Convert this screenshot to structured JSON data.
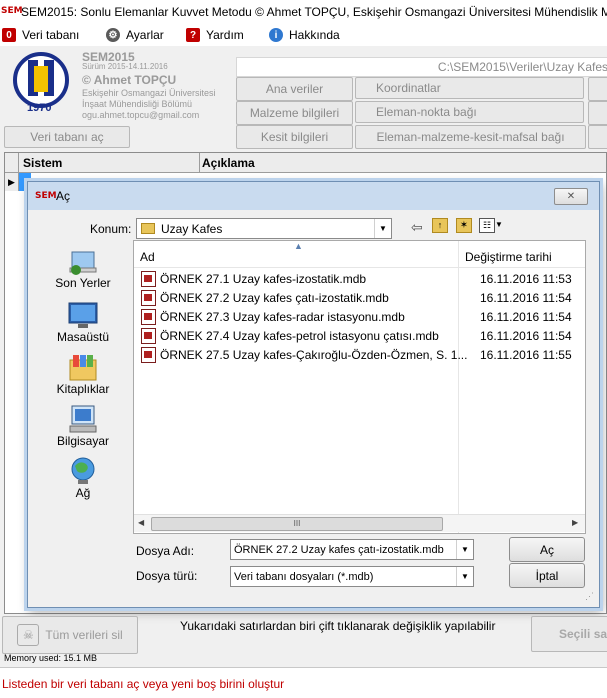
{
  "window": {
    "logo_text": "SEM",
    "title": "SEM2015: Sonlu Elemanlar Kuvvet Metodu  © Ahmet TOPÇU, Eskişehir Osmangazi Üniversitesi Mühendislik M"
  },
  "menu": {
    "items": [
      {
        "label": "Veri tabanı",
        "icon": "zero-icon"
      },
      {
        "label": "Ayarlar",
        "icon": "gear-icon"
      },
      {
        "label": "Yardım",
        "icon": "help-icon"
      },
      {
        "label": "Hakkında",
        "icon": "info-icon"
      }
    ]
  },
  "header": {
    "logo_year": "1970",
    "app_name": "SEM2015",
    "version": "Sürüm 2015-14.11.2016",
    "author": "© Ahmet TOPÇU",
    "university": "Eskişehir Osmangazi Üniversitesi",
    "department": "İnşaat Mühendisliği Bölümü",
    "email": "ogu.ahmet.topcu@gmail.com",
    "open_db_button": "Veri tabanı aç",
    "path": "C:\\SEM2015\\Veriler\\Uzay Kafes",
    "buttons": {
      "ana_veriler": "Ana veriler",
      "koordinatlar": "Koordinatlar",
      "malzeme": "Malzeme bilgileri",
      "eleman_nokta": "Eleman-nokta bağı",
      "kesit": "Kesit bilgileri",
      "eleman_malzeme": "Eleman-malzeme-kesit-mafsal bağı"
    }
  },
  "grid": {
    "columns": [
      "Sistem",
      "Açıklama"
    ],
    "row_marker": "▶"
  },
  "dialog": {
    "logo_text": "SEM",
    "title": "Aç",
    "close_label": "✕",
    "konum_label": "Konum:",
    "konum_value": "Uzay Kafes",
    "places": [
      {
        "label": "Son Yerler",
        "icon": "recent-places-icon"
      },
      {
        "label": "Masaüstü",
        "icon": "desktop-icon"
      },
      {
        "label": "Kitaplıklar",
        "icon": "libraries-icon"
      },
      {
        "label": "Bilgisayar",
        "icon": "computer-icon"
      },
      {
        "label": "Ağ",
        "icon": "network-icon"
      }
    ],
    "columns": {
      "name": "Ad",
      "date": "Değiştirme tarihi"
    },
    "files": [
      {
        "name": "ÖRNEK 27.1 Uzay kafes-izostatik.mdb",
        "date": "16.11.2016 11:53"
      },
      {
        "name": "ÖRNEK 27.2 Uzay kafes çatı-izostatik.mdb",
        "date": "16.11.2016 11:54"
      },
      {
        "name": "ÖRNEK 27.3 Uzay kafes-radar istasyonu.mdb",
        "date": "16.11.2016 11:54"
      },
      {
        "name": "ÖRNEK 27.4 Uzay kafes-petrol istasyonu çatısı.mdb",
        "date": "16.11.2016 11:54"
      },
      {
        "name": "ÖRNEK 27.5 Uzay kafes-Çakıroğlu-Özden-Özmen, S. 1...",
        "date": "16.11.2016 11:55"
      }
    ],
    "scroll_grip": "III",
    "filename_label": "Dosya Adı:",
    "filename_value": "ÖRNEK 27.2 Uzay kafes çatı-izostatik.mdb",
    "filetype_label": "Dosya türü:",
    "filetype_value": "Veri tabanı dosyaları (*.mdb)",
    "open_button": "Aç",
    "cancel_button": "İptal"
  },
  "bottom": {
    "delete_all_button": "Tüm verileri sil",
    "hint": "Yukarıdaki satırlardan biri çift tıklanarak değişiklik yapılabilir",
    "selected_button": "Seçili sat",
    "memory": "Memory used: 15.1 MB",
    "status": "Listeden bir veri tabanı aç veya yeni boş birini oluştur"
  },
  "colors": {
    "accent_red": "#c00000",
    "dialog_title_bg": "#c9dbef",
    "selection_blue": "#3399ff"
  }
}
